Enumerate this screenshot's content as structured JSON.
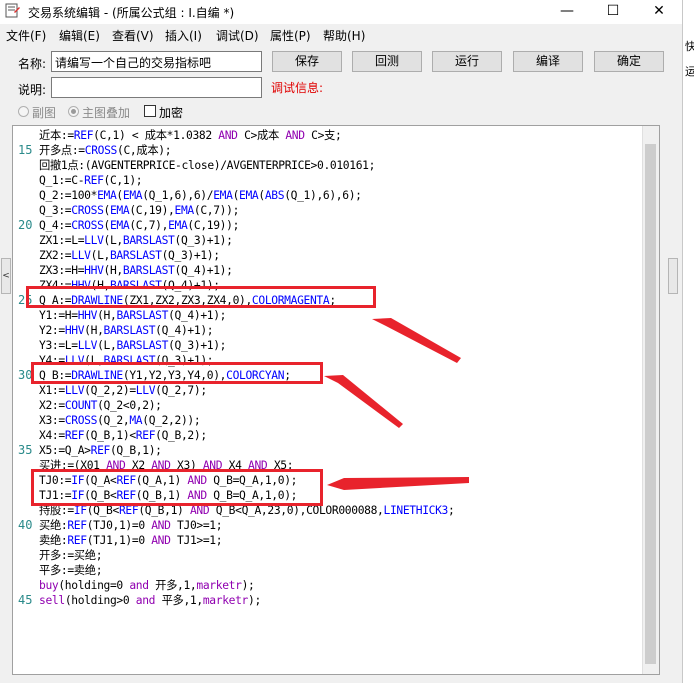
{
  "window": {
    "title": "交易系统编辑 - (所属公式组 : I.自编 *)",
    "minimize": "—",
    "maximize": "☐",
    "close": "✕"
  },
  "menu": [
    "文件(F)",
    "编辑(E)",
    "查看(V)",
    "插入(I)",
    "调试(D)",
    "属性(P)",
    "帮助(H)"
  ],
  "form": {
    "name_label": "名称:",
    "name_value": "请编写一个自己的交易指标吧",
    "desc_label": "说明:",
    "desc_value": "",
    "debug_label": "调试信息:",
    "radio_subchart": "副图",
    "radio_mainchart": "主图叠加",
    "checkbox_encrypt": "加密"
  },
  "buttons": {
    "save": "保存",
    "rollback": "回测",
    "run": "运行",
    "compile": "编译",
    "ok": "确定"
  },
  "side_panel": {
    "left_tab_glyph": "<",
    "right_chars": [
      "快",
      "运"
    ]
  },
  "line_numbers": [
    {
      "n": "15",
      "row": 1
    },
    {
      "n": "20",
      "row": 6
    },
    {
      "n": "25",
      "row": 11
    },
    {
      "n": "30",
      "row": 16
    },
    {
      "n": "35",
      "row": 21
    },
    {
      "n": "40",
      "row": 26
    },
    {
      "n": "45",
      "row": 31
    }
  ],
  "code_lines": [
    [
      {
        "t": "近本:="
      },
      {
        "t": "REF",
        "c": "fn"
      },
      {
        "t": "(C,1) < 成本*1.0382 "
      },
      {
        "t": "AND",
        "c": "kw"
      },
      {
        "t": " C>成本 "
      },
      {
        "t": "AND",
        "c": "kw"
      },
      {
        "t": " C>支;"
      }
    ],
    [
      {
        "t": "开多点:="
      },
      {
        "t": "CROSS",
        "c": "fn"
      },
      {
        "t": "(C,成本);"
      }
    ],
    [
      {
        "t": "回撤1点:(AVGENTERPRICE-close)/AVGENTERPRICE>0.010161;"
      }
    ],
    [
      {
        "t": "Q_1:=C-"
      },
      {
        "t": "REF",
        "c": "fn"
      },
      {
        "t": "(C,1);"
      }
    ],
    [
      {
        "t": "Q_2:=100*"
      },
      {
        "t": "EMA",
        "c": "fn"
      },
      {
        "t": "("
      },
      {
        "t": "EMA",
        "c": "fn"
      },
      {
        "t": "(Q_1,6),6)/"
      },
      {
        "t": "EMA",
        "c": "fn"
      },
      {
        "t": "("
      },
      {
        "t": "EMA",
        "c": "fn"
      },
      {
        "t": "("
      },
      {
        "t": "ABS",
        "c": "fn"
      },
      {
        "t": "(Q_1),6),6);"
      }
    ],
    [
      {
        "t": "Q_3:="
      },
      {
        "t": "CROSS",
        "c": "fn"
      },
      {
        "t": "("
      },
      {
        "t": "EMA",
        "c": "fn"
      },
      {
        "t": "(C,19),"
      },
      {
        "t": "EMA",
        "c": "fn"
      },
      {
        "t": "(C,7));"
      }
    ],
    [
      {
        "t": "Q_4:="
      },
      {
        "t": "CROSS",
        "c": "fn"
      },
      {
        "t": "("
      },
      {
        "t": "EMA",
        "c": "fn"
      },
      {
        "t": "(C,7),"
      },
      {
        "t": "EMA",
        "c": "fn"
      },
      {
        "t": "(C,19));"
      }
    ],
    [
      {
        "t": "ZX1:=L="
      },
      {
        "t": "LLV",
        "c": "fn"
      },
      {
        "t": "(L,"
      },
      {
        "t": "BARSLAST",
        "c": "fn"
      },
      {
        "t": "(Q_3)+1);"
      }
    ],
    [
      {
        "t": "ZX2:="
      },
      {
        "t": "LLV",
        "c": "fn"
      },
      {
        "t": "(L,"
      },
      {
        "t": "BARSLAST",
        "c": "fn"
      },
      {
        "t": "(Q_3)+1);"
      }
    ],
    [
      {
        "t": "ZX3:=H="
      },
      {
        "t": "HHV",
        "c": "fn"
      },
      {
        "t": "(H,"
      },
      {
        "t": "BARSLAST",
        "c": "fn"
      },
      {
        "t": "(Q_4)+1);"
      }
    ],
    [
      {
        "t": "ZX4:="
      },
      {
        "t": "HHV",
        "c": "fn"
      },
      {
        "t": "(H,"
      },
      {
        "t": "BARSLAST",
        "c": "fn"
      },
      {
        "t": "(Q_4)+1);"
      }
    ],
    [
      {
        "t": "Q_A:="
      },
      {
        "t": "DRAWLINE",
        "c": "fn"
      },
      {
        "t": "(ZX1,ZX2,ZX3,ZX4,0),"
      },
      {
        "t": "COLORMAGENTA",
        "c": "fn"
      },
      {
        "t": ";"
      }
    ],
    [
      {
        "t": "Y1:=H="
      },
      {
        "t": "HHV",
        "c": "fn"
      },
      {
        "t": "(H,"
      },
      {
        "t": "BARSLAST",
        "c": "fn"
      },
      {
        "t": "(Q_4)+1);"
      }
    ],
    [
      {
        "t": "Y2:="
      },
      {
        "t": "HHV",
        "c": "fn"
      },
      {
        "t": "(H,"
      },
      {
        "t": "BARSLAST",
        "c": "fn"
      },
      {
        "t": "(Q_4)+1);"
      }
    ],
    [
      {
        "t": "Y3:=L="
      },
      {
        "t": "LLV",
        "c": "fn"
      },
      {
        "t": "(L,"
      },
      {
        "t": "BARSLAST",
        "c": "fn"
      },
      {
        "t": "(Q_3)+1);"
      }
    ],
    [
      {
        "t": "Y4:="
      },
      {
        "t": "LLV",
        "c": "fn"
      },
      {
        "t": "(L,"
      },
      {
        "t": "BARSLAST",
        "c": "fn"
      },
      {
        "t": "(Q_3)+1);"
      }
    ],
    [
      {
        "t": "Q_B:="
      },
      {
        "t": "DRAWLINE",
        "c": "fn"
      },
      {
        "t": "(Y1,Y2,Y3,Y4,0),"
      },
      {
        "t": "COLORCYAN",
        "c": "fn"
      },
      {
        "t": ";"
      }
    ],
    [
      {
        "t": "X1:="
      },
      {
        "t": "LLV",
        "c": "fn"
      },
      {
        "t": "(Q_2,2)="
      },
      {
        "t": "LLV",
        "c": "fn"
      },
      {
        "t": "(Q_2,7);"
      }
    ],
    [
      {
        "t": "X2:="
      },
      {
        "t": "COUNT",
        "c": "fn"
      },
      {
        "t": "(Q_2<0,2);"
      }
    ],
    [
      {
        "t": "X3:="
      },
      {
        "t": "CROSS",
        "c": "fn"
      },
      {
        "t": "(Q_2,"
      },
      {
        "t": "MA",
        "c": "fn"
      },
      {
        "t": "(Q_2,2));"
      }
    ],
    [
      {
        "t": "X4:="
      },
      {
        "t": "REF",
        "c": "fn"
      },
      {
        "t": "(Q_B,1)<"
      },
      {
        "t": "REF",
        "c": "fn"
      },
      {
        "t": "(Q_B,2);"
      }
    ],
    [
      {
        "t": "X5:=Q_A>"
      },
      {
        "t": "REF",
        "c": "fn"
      },
      {
        "t": "(Q_B,1);"
      }
    ],
    [
      {
        "t": "买进:=(X01 "
      },
      {
        "t": "AND",
        "c": "kw"
      },
      {
        "t": " X2 "
      },
      {
        "t": "AND",
        "c": "kw"
      },
      {
        "t": " X3) "
      },
      {
        "t": "AND",
        "c": "kw"
      },
      {
        "t": " X4 "
      },
      {
        "t": "AND",
        "c": "kw"
      },
      {
        "t": " X5;"
      }
    ],
    [
      {
        "t": "TJ0:="
      },
      {
        "t": "IF",
        "c": "fn"
      },
      {
        "t": "(Q_A<"
      },
      {
        "t": "REF",
        "c": "fn"
      },
      {
        "t": "(Q_A,1) "
      },
      {
        "t": "AND",
        "c": "kw"
      },
      {
        "t": " Q_B=Q_A,1,0);"
      }
    ],
    [
      {
        "t": "TJ1:="
      },
      {
        "t": "IF",
        "c": "fn"
      },
      {
        "t": "(Q_B<"
      },
      {
        "t": "REF",
        "c": "fn"
      },
      {
        "t": "(Q_B,1) "
      },
      {
        "t": "AND",
        "c": "kw"
      },
      {
        "t": " Q_B=Q_A,1,0);"
      }
    ],
    [
      {
        "t": "持股:="
      },
      {
        "t": "IF",
        "c": "fn"
      },
      {
        "t": "(Q_B<"
      },
      {
        "t": "REF",
        "c": "fn"
      },
      {
        "t": "(Q_B,1) "
      },
      {
        "t": "AND",
        "c": "kw"
      },
      {
        "t": " Q_B<Q_A,23,0),COLOR000088,"
      },
      {
        "t": "LINETHICK3",
        "c": "fn"
      },
      {
        "t": ";"
      }
    ],
    [
      {
        "t": "买绝:"
      },
      {
        "t": "REF",
        "c": "fn"
      },
      {
        "t": "(TJ0,1)=0 "
      },
      {
        "t": "AND",
        "c": "kw"
      },
      {
        "t": " TJ0>=1;"
      }
    ],
    [
      {
        "t": "卖绝:"
      },
      {
        "t": "REF",
        "c": "fn"
      },
      {
        "t": "(TJ1,1)=0 "
      },
      {
        "t": "AND",
        "c": "kw"
      },
      {
        "t": " TJ1>=1;"
      }
    ],
    [
      {
        "t": "开多:=买绝;"
      }
    ],
    [
      {
        "t": "平多:=卖绝;"
      }
    ],
    [
      {
        "t": "buy",
        "c": "kw"
      },
      {
        "t": "(holding=0 "
      },
      {
        "t": "and",
        "c": "kw"
      },
      {
        "t": " 开多,1,"
      },
      {
        "t": "marketr",
        "c": "kw"
      },
      {
        "t": ");"
      }
    ],
    [
      {
        "t": "sell",
        "c": "kw"
      },
      {
        "t": "(holding>0 "
      },
      {
        "t": "and",
        "c": "kw"
      },
      {
        "t": " 平多,1,"
      },
      {
        "t": "marketr",
        "c": "kw"
      },
      {
        "t": ");"
      }
    ]
  ],
  "colors": {
    "function": "#0000ff",
    "keyword": "#9000b0",
    "annotation": "#e8232c",
    "debug": "#e00000",
    "line_number": "#2a8a8a"
  }
}
